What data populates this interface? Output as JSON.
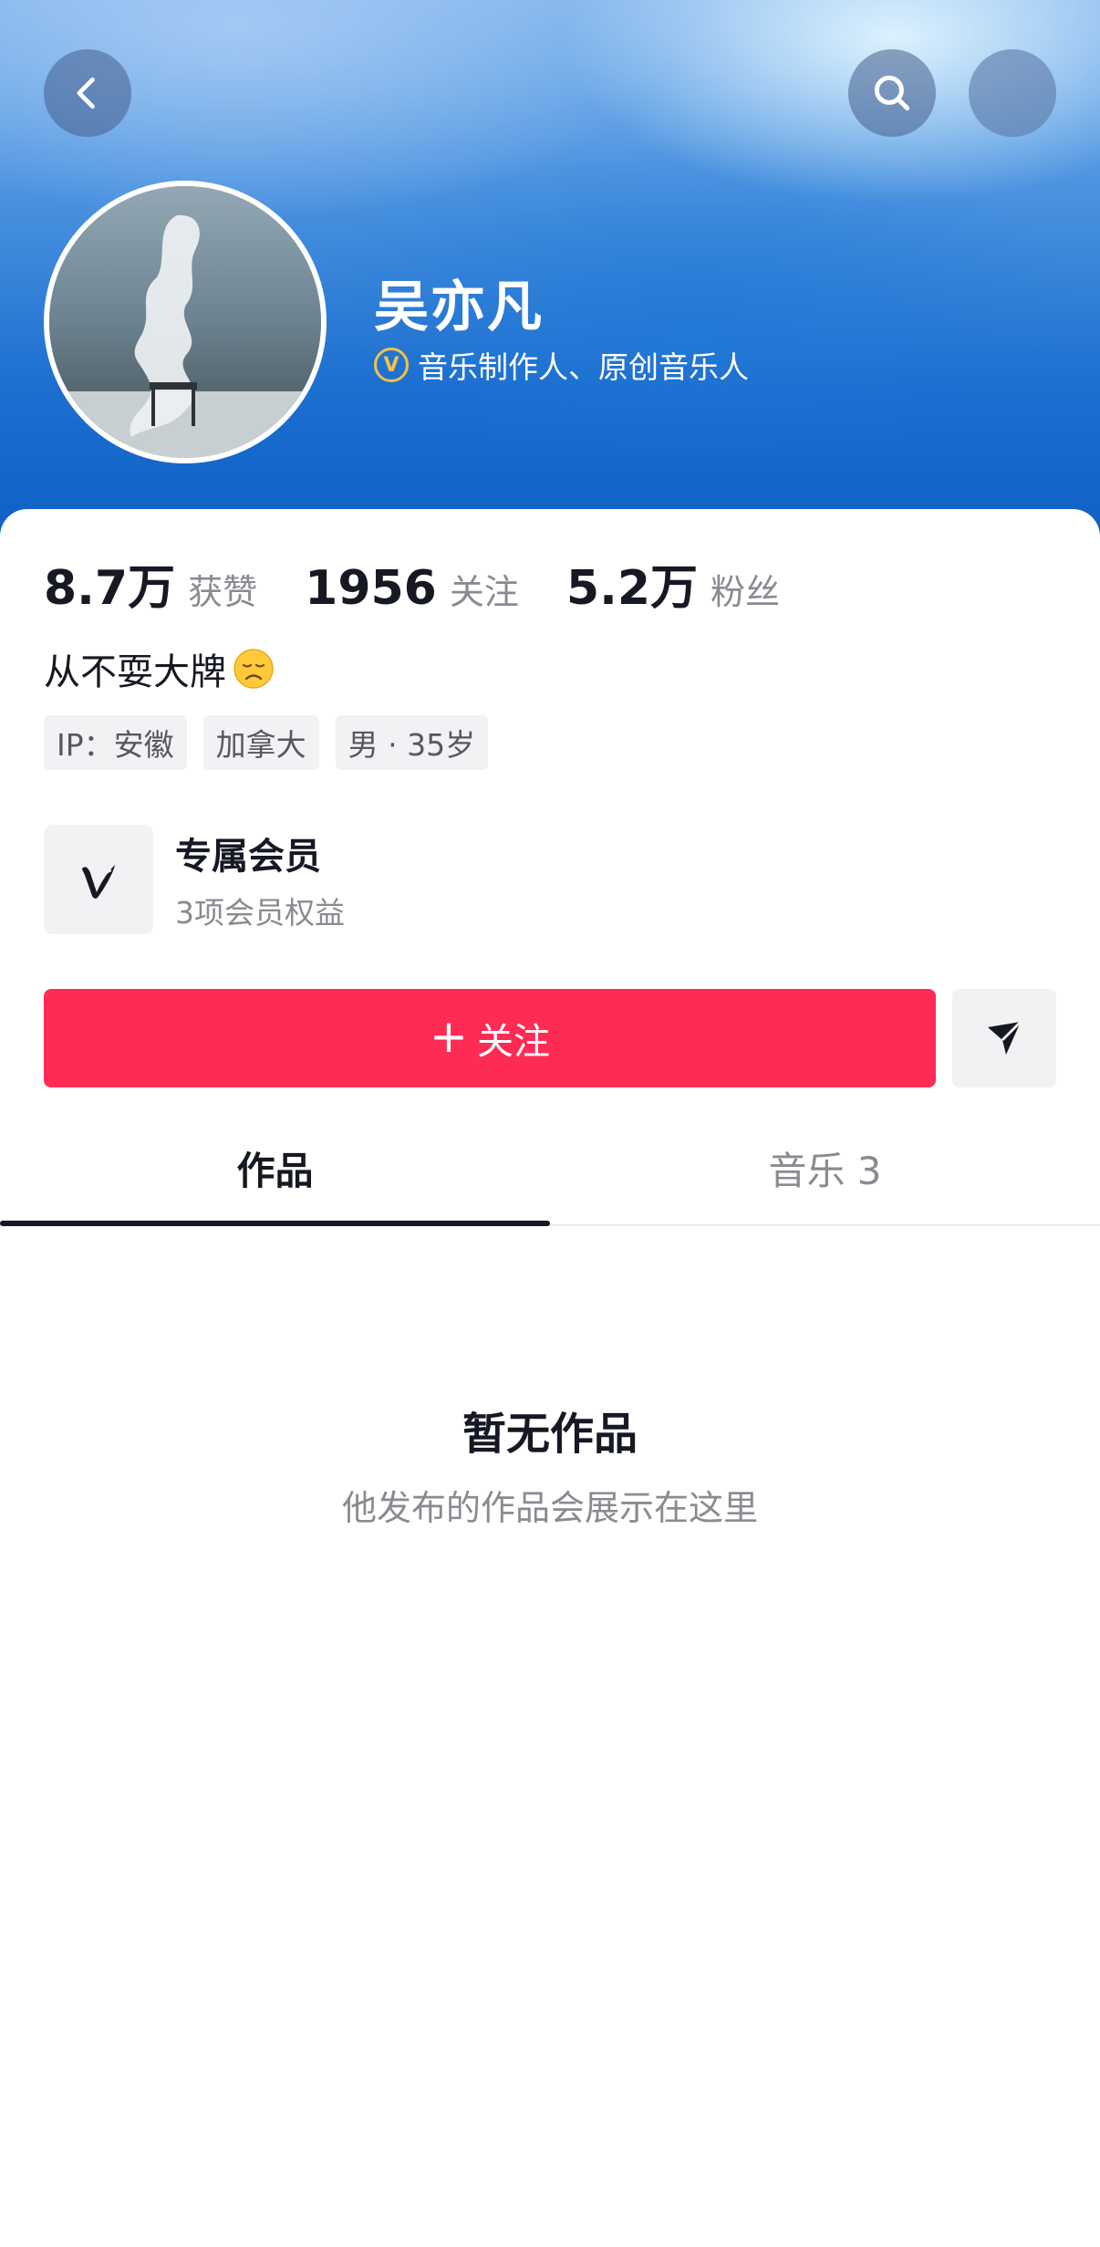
{
  "header": {
    "back_icon": "chevron-left-icon",
    "search_icon": "search-icon",
    "more_icon": "more-icon"
  },
  "profile": {
    "name": "吴亦凡",
    "verification_badge": "V",
    "verification_text": "音乐制作人、原创音乐人",
    "badge_color": "#f3c246"
  },
  "stats": [
    {
      "value": "8.7万",
      "label": "获赞"
    },
    {
      "value": "1956",
      "label": "关注"
    },
    {
      "value": "5.2万",
      "label": "粉丝"
    }
  ],
  "bio": {
    "text": "从不耍大牌",
    "emoji": "sad-face-emoji"
  },
  "tags": [
    {
      "label": "IP：安徽"
    },
    {
      "label": "加拿大"
    },
    {
      "label": "男 · 35岁"
    }
  ],
  "membership": {
    "title": "专属会员",
    "subtitle": "3项会员权益",
    "icon": "v-logo-icon"
  },
  "actions": {
    "follow_plus": "+",
    "follow_label": "关注",
    "follow_color": "#fe2c55",
    "share_icon": "send-icon"
  },
  "tabs": [
    {
      "label": "作品",
      "active": true
    },
    {
      "label": "音乐 3",
      "active": false
    }
  ],
  "empty_state": {
    "title": "暂无作品",
    "subtitle": "他发布的作品会展示在这里"
  }
}
